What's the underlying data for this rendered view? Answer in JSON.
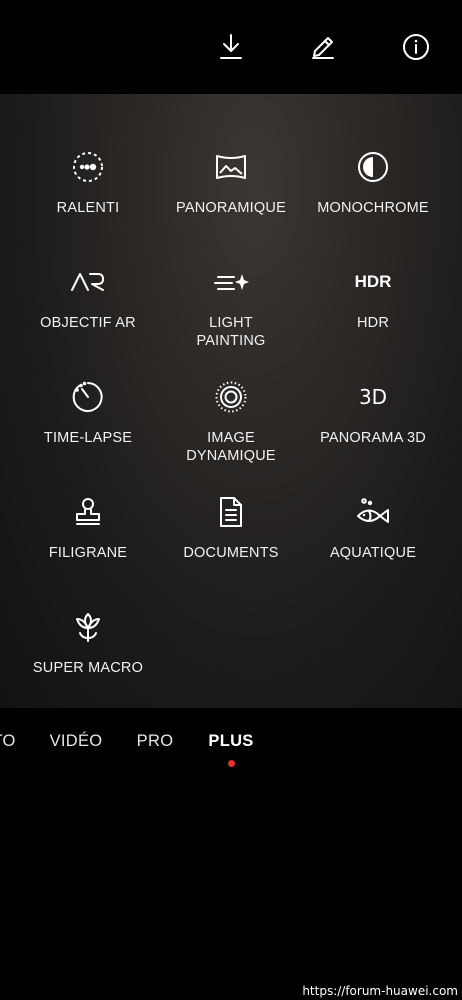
{
  "top_bar": {
    "icons": [
      "download-icon",
      "edit-icon",
      "info-icon"
    ]
  },
  "modes": [
    {
      "label": "RALENTI",
      "icon": "slow-motion-icon"
    },
    {
      "label": "PANORAMIQUE",
      "icon": "panorama-icon"
    },
    {
      "label": "MONOCHROME",
      "icon": "monochrome-icon"
    },
    {
      "label": "OBJECTIF AR",
      "icon": "ar-lens-icon",
      "icon_text": "AR"
    },
    {
      "label": "LIGHT\nPAINTING",
      "icon": "light-painting-icon"
    },
    {
      "label": "HDR",
      "icon": "hdr-icon",
      "icon_text": "HDR"
    },
    {
      "label": "TIME-LAPSE",
      "icon": "time-lapse-icon"
    },
    {
      "label": "IMAGE\nDYNAMIQUE",
      "icon": "moving-picture-icon"
    },
    {
      "label": "PANORAMA 3D",
      "icon": "panorama-3d-icon",
      "icon_text": "3D"
    },
    {
      "label": "FILIGRANE",
      "icon": "watermark-stamp-icon"
    },
    {
      "label": "DOCUMENTS",
      "icon": "document-icon"
    },
    {
      "label": "AQUATIQUE",
      "icon": "fish-icon"
    },
    {
      "label": "SUPER MACRO",
      "icon": "flower-icon"
    }
  ],
  "tabs": [
    {
      "label": "TO",
      "active": false
    },
    {
      "label": "VIDÉO",
      "active": false
    },
    {
      "label": "PRO",
      "active": false
    },
    {
      "label": "PLUS",
      "active": true
    }
  ],
  "colors": {
    "active_dot": "#e0342f",
    "background": "#000000"
  },
  "watermark": "https://forum-huawei.com"
}
